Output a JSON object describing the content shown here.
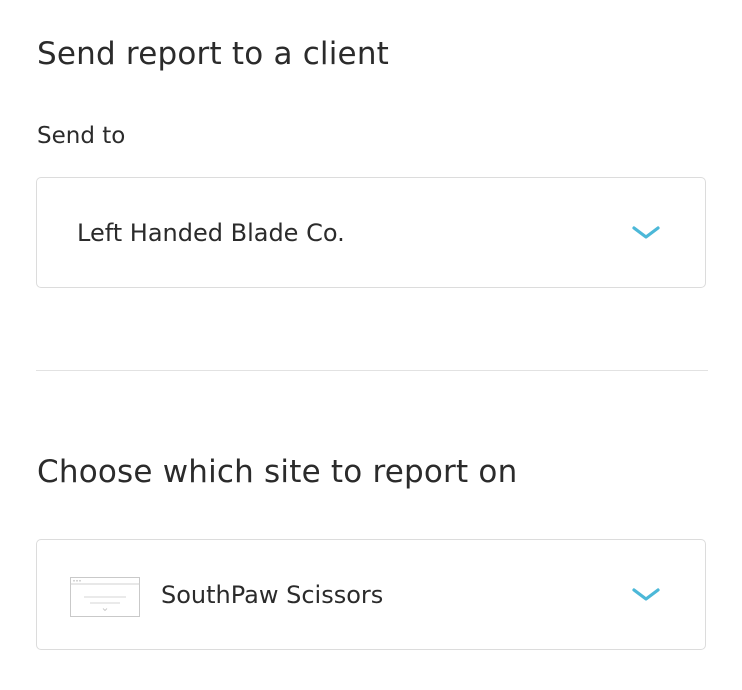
{
  "send_section": {
    "title": "Send report to a client",
    "field_label": "Send to",
    "selected_client": "Left Handed Blade Co."
  },
  "site_section": {
    "title": "Choose which site to report on",
    "selected_site": "SouthPaw Scissors"
  },
  "icons": {
    "dropdown": "chevron-down-icon",
    "site_thumbnail": "website-thumbnail-icon"
  },
  "colors": {
    "accent": "#4cb8d8",
    "text": "#2b2b2b",
    "border": "#dcdcdc"
  }
}
